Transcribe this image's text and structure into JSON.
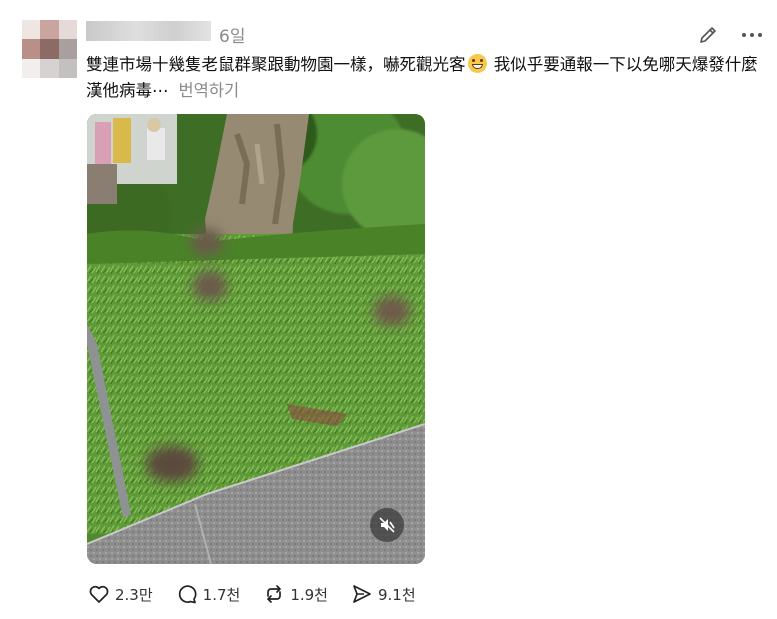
{
  "post": {
    "timestamp": "6일",
    "text": "雙連市場十幾隻老鼠群聚跟動物園一樣，嚇死觀光客",
    "text_after_emoji": "我似乎要通報一下以免哪天爆發什麼漢他病毒⋯",
    "translate_label": "번역하기",
    "emoji": "grinning-face-with-sweat"
  },
  "media": {
    "type": "video",
    "muted": true
  },
  "actions": {
    "likes": "2.3만",
    "comments": "1.7천",
    "reposts": "1.9천",
    "shares": "9.1천"
  },
  "colors": {
    "grass": "#5f9a38",
    "pavement": "#8c8c8c",
    "secondary_text": "#8a8a8a"
  }
}
